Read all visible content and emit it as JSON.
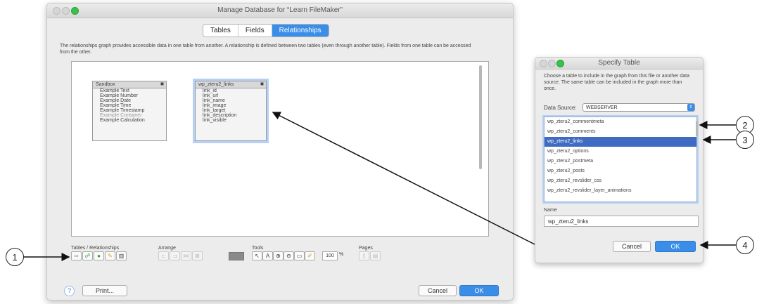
{
  "main_window": {
    "title": "Manage Database for “Learn FileMaker”",
    "tabs": [
      "Tables",
      "Fields",
      "Relationships"
    ],
    "active_tab": "Relationships",
    "description": "The relationships graph provides accessible data in one table from another. A relationship is defined between two tables (even through another table). Fields from one table can be accessed from the other.",
    "table_occurrences": [
      {
        "name": "Sandbox",
        "fields": [
          "Example Text",
          "Example Number",
          "Example Date",
          "Example Time",
          "Example Timestamp",
          "Example Container",
          "Example Calculation"
        ]
      },
      {
        "name": "wp_zteru2_links",
        "fields": [
          "link_id",
          "link_url",
          "link_name",
          "link_image",
          "link_target",
          "link_description",
          "link_visible"
        ]
      }
    ],
    "sections": {
      "tables_relationships": "Tables / Relationships",
      "arrange": "Arrange",
      "tools": "Tools",
      "pages": "Pages"
    },
    "zoom": "100",
    "zoom_unit": "%",
    "print_button": "Print...",
    "cancel_button": "Cancel",
    "ok_button": "OK",
    "help_icon": "?"
  },
  "specify_table_dialog": {
    "title": "Specify Table",
    "description": "Choose a table to include in the graph from this file or another data source. The same table can be included in the graph more than once.",
    "data_source_label": "Data Source:",
    "data_source_value": "WEBSERVER",
    "tables": [
      "wp_zteru2_commentmeta",
      "wp_zteru2_comments",
      "wp_zteru2_links",
      "wp_zteru2_options",
      "wp_zteru2_postmeta",
      "wp_zteru2_posts",
      "wp_zteru2_revslider_css",
      "wp_zteru2_revslider_layer_animations"
    ],
    "selected_table": "wp_zteru2_links",
    "name_label": "Name",
    "name_value": "wp_zteru2_links",
    "cancel_button": "Cancel",
    "ok_button": "OK"
  },
  "callouts": [
    "1",
    "2",
    "3",
    "4"
  ]
}
